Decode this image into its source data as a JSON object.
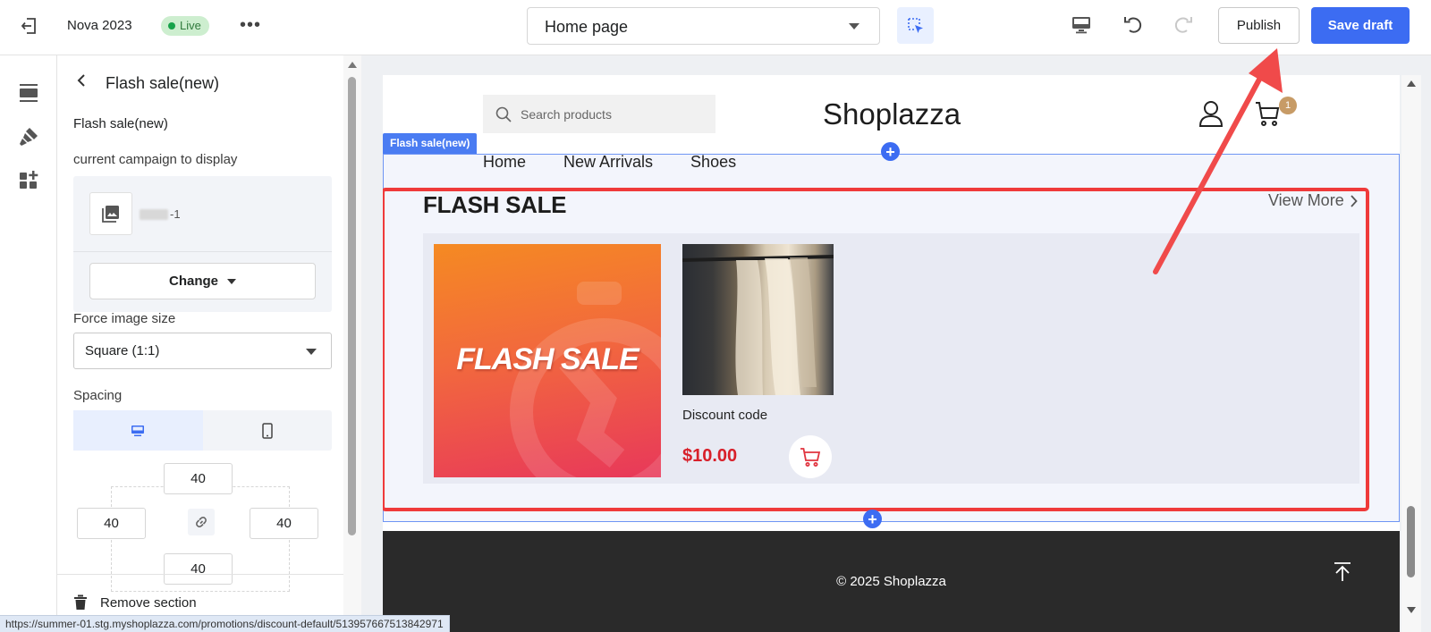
{
  "topbar": {
    "store_name": "Nova 2023",
    "live_label": "Live",
    "more_label": "•••",
    "page_select_value": "Home page",
    "publish_label": "Publish",
    "save_draft_label": "Save draft"
  },
  "panel": {
    "title": "Flash sale(new)",
    "section_title": "Flash sale(new)",
    "campaign_label": "current campaign to display",
    "campaign_name_suffix": "-1",
    "change_label": "Change",
    "force_image_label": "Force image size",
    "force_image_value": "Square (1:1)",
    "spacing_label": "Spacing",
    "spacing": {
      "top": "40",
      "left": "40",
      "right": "40",
      "bottom": "40"
    },
    "remove_label": "Remove section"
  },
  "preview": {
    "search_placeholder": "Search products",
    "logo": "Shoplazza",
    "cart_count": "1",
    "section_tag": "Flash sale(new)",
    "nav": [
      "Home",
      "New Arrivals",
      "Shoes"
    ],
    "flash_heading": "FLASH SALE",
    "view_more": "View More",
    "banner_text": "FLASH SALE",
    "product": {
      "name": "Discount code",
      "price": "$10.00"
    },
    "footer_text": "© 2025 Shoplazza"
  },
  "status_url": "https://summer-01.stg.myshoplazza.com/promotions/discount-default/513957667513842971",
  "colors": {
    "accent": "#3c6cf2",
    "live_bg": "#cdeecf",
    "highlight": "#ef3a3a",
    "price": "#d8202a",
    "footer_bg": "#2a2a2a"
  },
  "icons": [
    "exit-icon",
    "more-icon",
    "inspect-icon",
    "desktop-icon",
    "undo-icon",
    "redo-icon",
    "sections-icon",
    "theme-settings-icon",
    "apps-icon",
    "back-icon",
    "image-icon",
    "mobile-icon",
    "link-icon",
    "trash-icon",
    "search-icon",
    "user-icon",
    "cart-icon",
    "add-section-icon",
    "back-to-top-icon"
  ]
}
